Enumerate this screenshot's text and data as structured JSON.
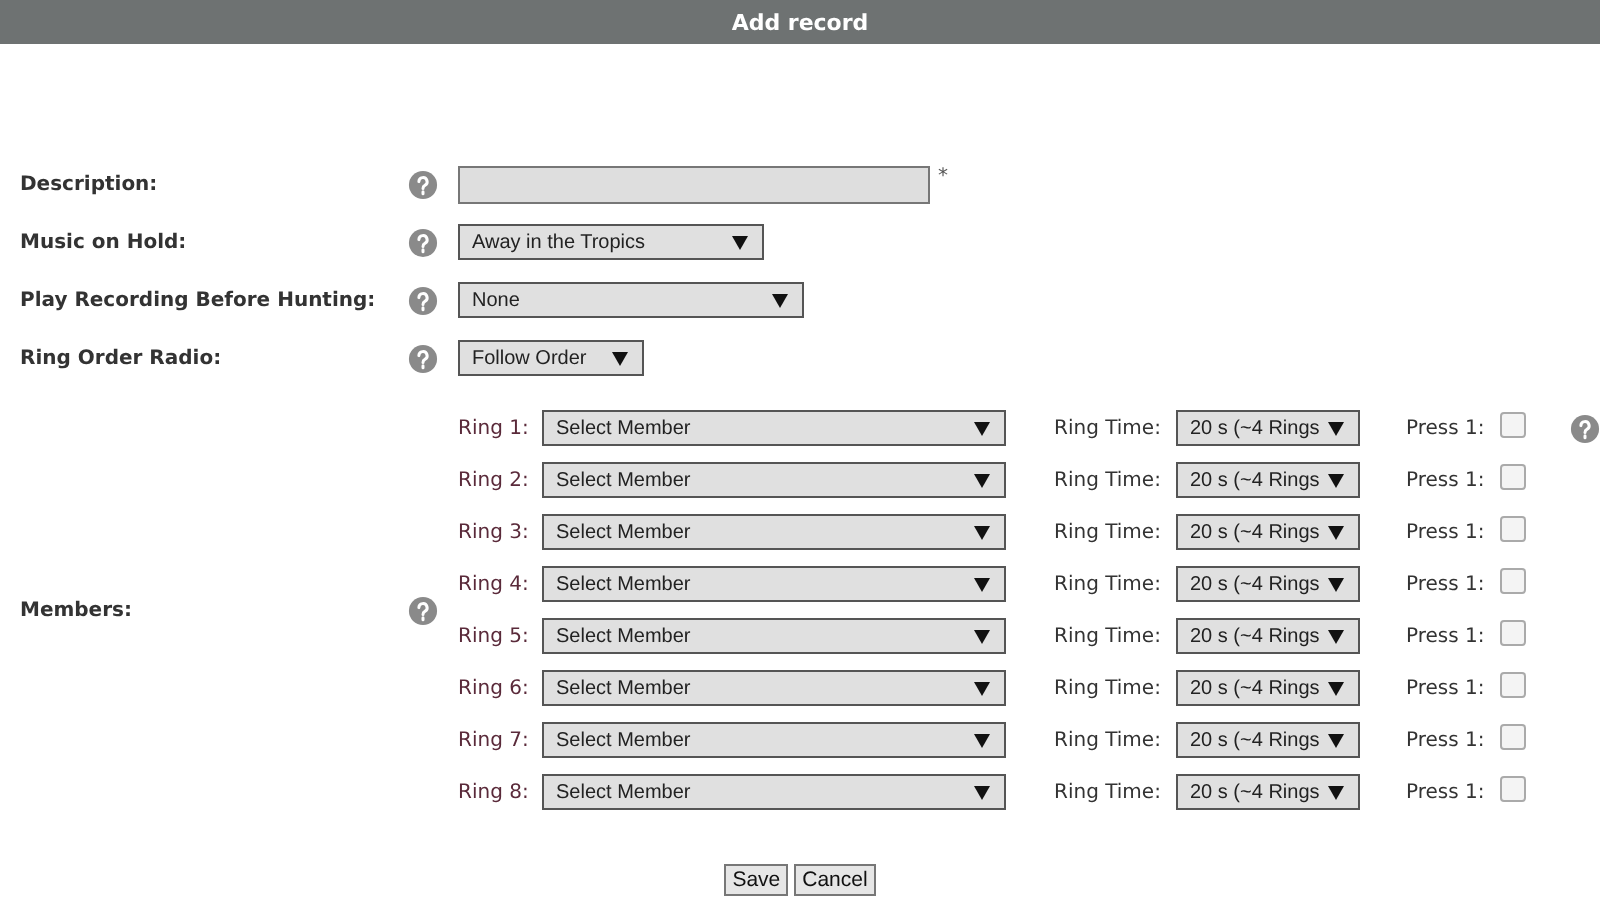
{
  "window": {
    "title": "Add record"
  },
  "fields": [
    {
      "label": "Description:",
      "kind": "text",
      "required_mark": "*"
    },
    {
      "label": "Music on Hold:",
      "kind": "select",
      "value": "Away in the Tropics"
    },
    {
      "label": "Play Recording Before Hunting:",
      "kind": "select",
      "value": "None"
    },
    {
      "label": "Ring Order Radio:",
      "kind": "select",
      "value": "Follow Order"
    }
  ],
  "members": {
    "label": "Members:",
    "rings": [
      {
        "label": "Ring 1:",
        "member": "Select Member",
        "time_label": "Ring Time:",
        "time": "20 s (~4 Rings",
        "press_label": "Press 1:",
        "checked": false
      },
      {
        "label": "Ring 2:",
        "member": "Select Member",
        "time_label": "Ring Time:",
        "time": "20 s (~4 Rings",
        "press_label": "Press 1:",
        "checked": false
      },
      {
        "label": "Ring 3:",
        "member": "Select Member",
        "time_label": "Ring Time:",
        "time": "20 s (~4 Rings",
        "press_label": "Press 1:",
        "checked": false
      },
      {
        "label": "Ring 4:",
        "member": "Select Member",
        "time_label": "Ring Time:",
        "time": "20 s (~4 Rings",
        "press_label": "Press 1:",
        "checked": false
      },
      {
        "label": "Ring 5:",
        "member": "Select Member",
        "time_label": "Ring Time:",
        "time": "20 s (~4 Rings",
        "press_label": "Press 1:",
        "checked": false
      },
      {
        "label": "Ring 6:",
        "member": "Select Member",
        "time_label": "Ring Time:",
        "time": "20 s (~4 Rings",
        "press_label": "Press 1:",
        "checked": false
      },
      {
        "label": "Ring 7:",
        "member": "Select Member",
        "time_label": "Ring Time:",
        "time": "20 s (~4 Rings",
        "press_label": "Press 1:",
        "checked": false
      },
      {
        "label": "Ring 8:",
        "member": "Select Member",
        "time_label": "Ring Time:",
        "time": "20 s (~4 Rings",
        "press_label": "Press 1:",
        "checked": false
      }
    ]
  },
  "buttons": [
    "Save",
    "Cancel"
  ]
}
